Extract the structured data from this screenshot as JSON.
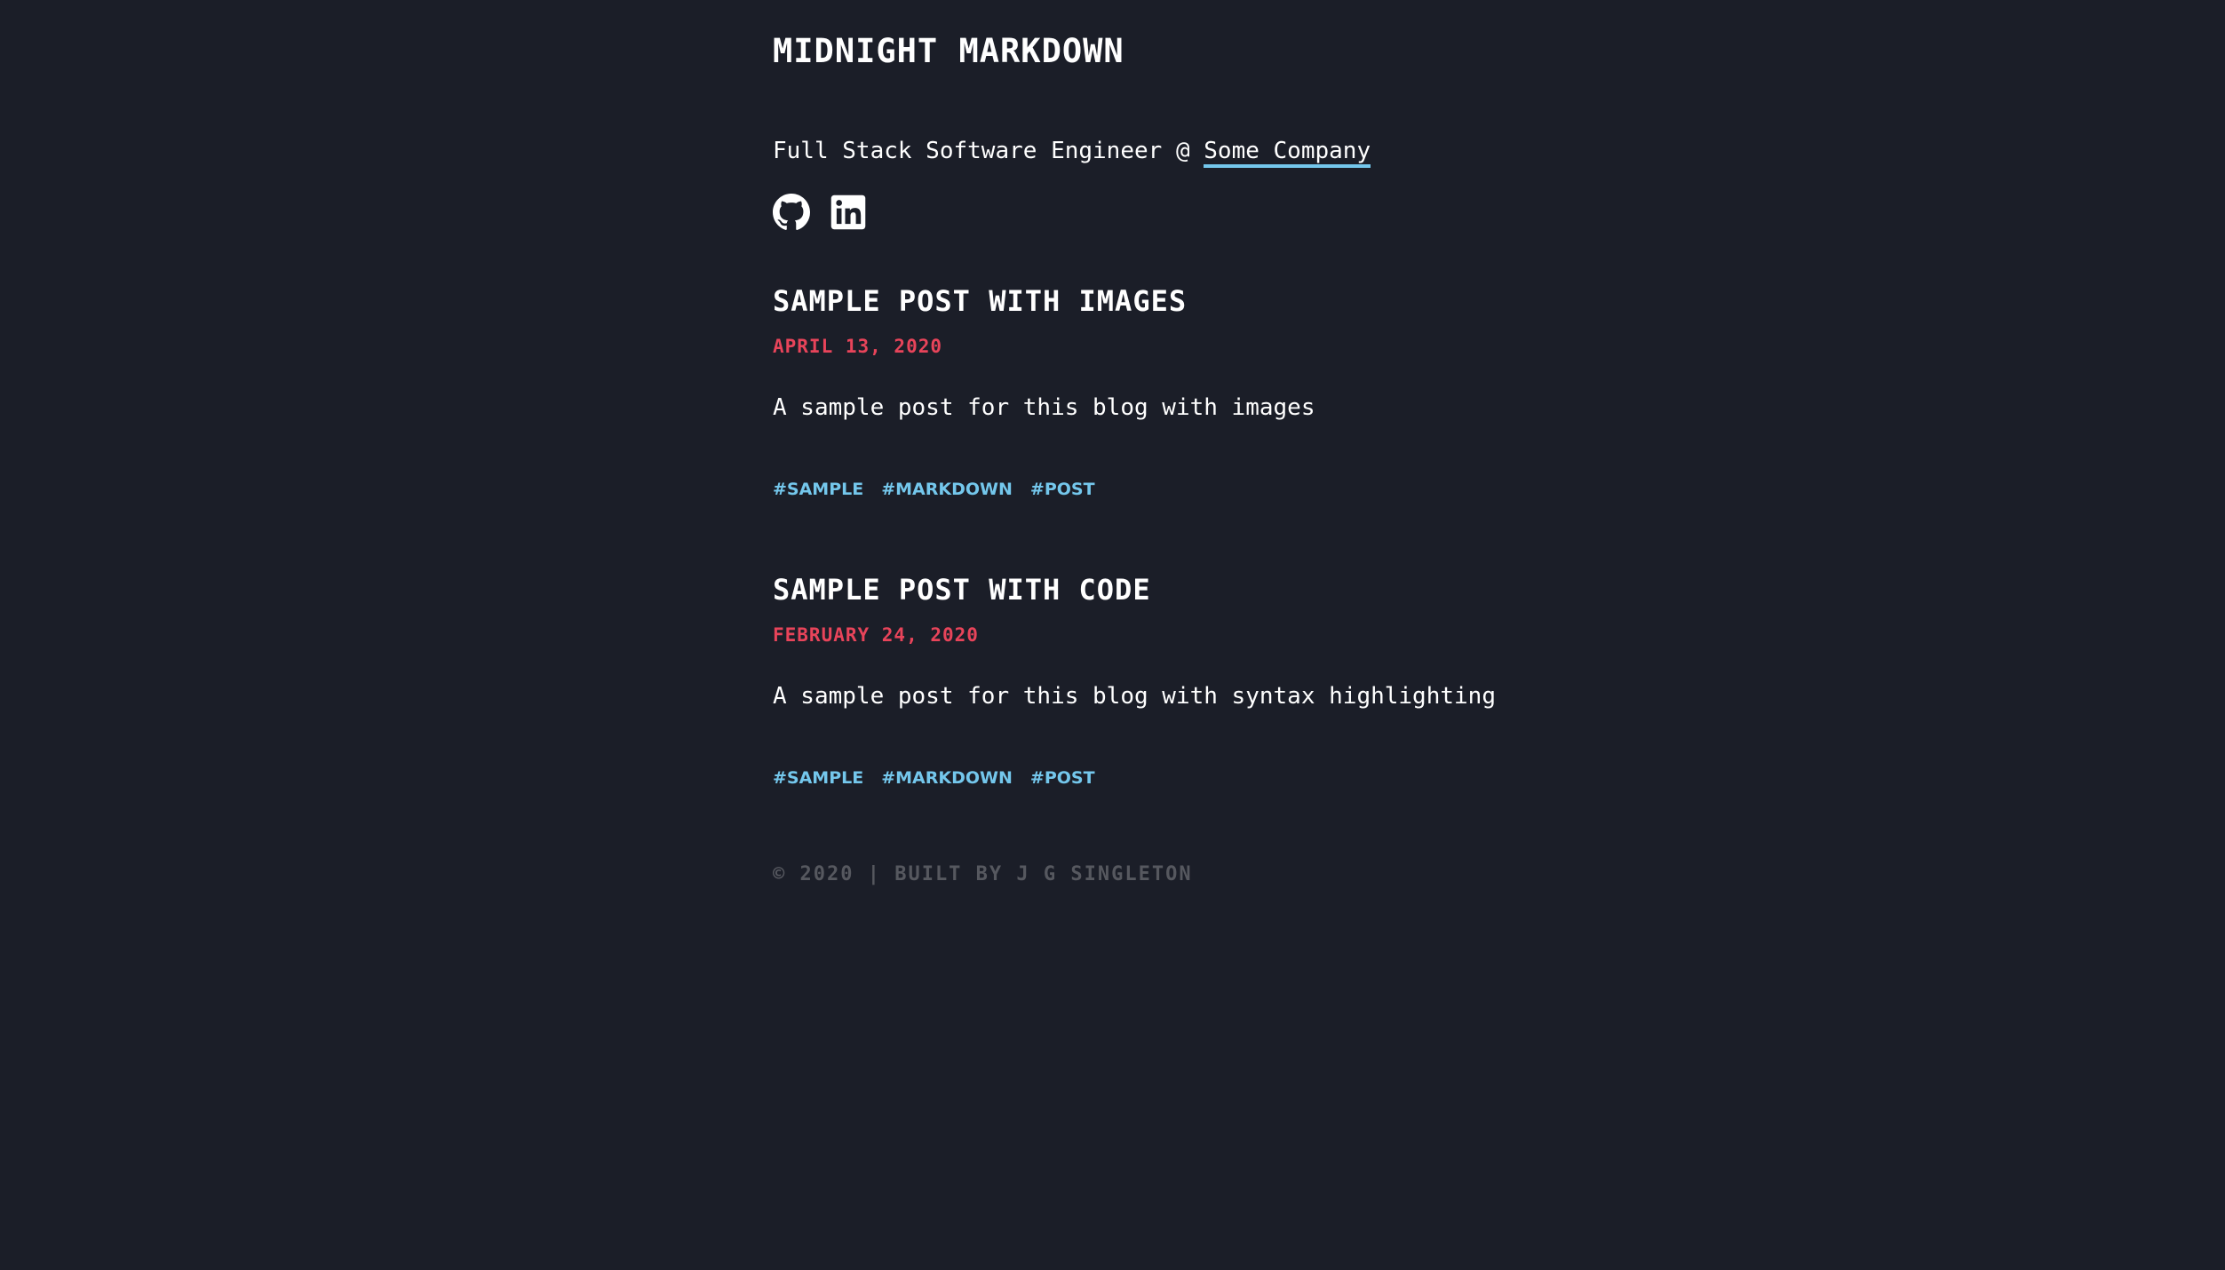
{
  "header": {
    "site_title": "MIDNIGHT MARKDOWN"
  },
  "bio": {
    "prefix": "Full Stack Software Engineer @ ",
    "company_link": "Some Company"
  },
  "socials": [
    {
      "icon": "github-icon"
    },
    {
      "icon": "linkedin-icon"
    }
  ],
  "posts": [
    {
      "title": "SAMPLE POST WITH IMAGES",
      "date": "APRIL 13, 2020",
      "description": "A sample post for this blog with images",
      "tags": [
        "#SAMPLE",
        "#MARKDOWN",
        "#POST"
      ]
    },
    {
      "title": "SAMPLE POST WITH CODE",
      "date": "FEBRUARY 24, 2020",
      "description": "A sample post for this blog with syntax highlighting",
      "tags": [
        "#SAMPLE",
        "#MARKDOWN",
        "#POST"
      ]
    }
  ],
  "footer": {
    "text": "© 2020 | BUILT BY J G SINGLETON"
  },
  "colors": {
    "background": "#1b1e28",
    "date": "#e8445a",
    "tag": "#74c7ec",
    "footer": "#56585f"
  }
}
